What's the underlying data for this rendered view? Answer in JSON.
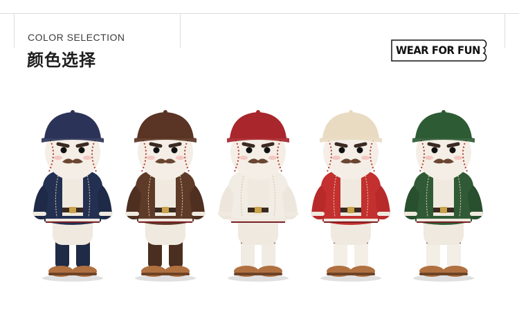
{
  "header": {
    "subtitle_en": "COLOR SELECTION",
    "title_cn": "颜色选择",
    "badge": "WEAR FOR FUN"
  },
  "figures": [
    {
      "name": "navy",
      "cap": "#2b3358",
      "jacket": "#233052",
      "sleeve": "#1e2a48",
      "sock": "#1f2a46"
    },
    {
      "name": "brown",
      "cap": "#5a3424",
      "jacket": "#5e3a28",
      "sleeve": "#4e2f20",
      "sock": "#4a2e20"
    },
    {
      "name": "white",
      "cap": "#a8262c",
      "jacket": "#f1ece4",
      "sleeve": "#ece6dc",
      "sock": "#f0ebe3"
    },
    {
      "name": "red",
      "cap": "#e9dbc2",
      "jacket": "#c4302f",
      "sleeve": "#b82a2a",
      "sock": "#f3eee6"
    },
    {
      "name": "green",
      "cap": "#2d5b34",
      "jacket": "#2f5a35",
      "sleeve": "#284f2e",
      "sock": "#f3eee6"
    }
  ]
}
